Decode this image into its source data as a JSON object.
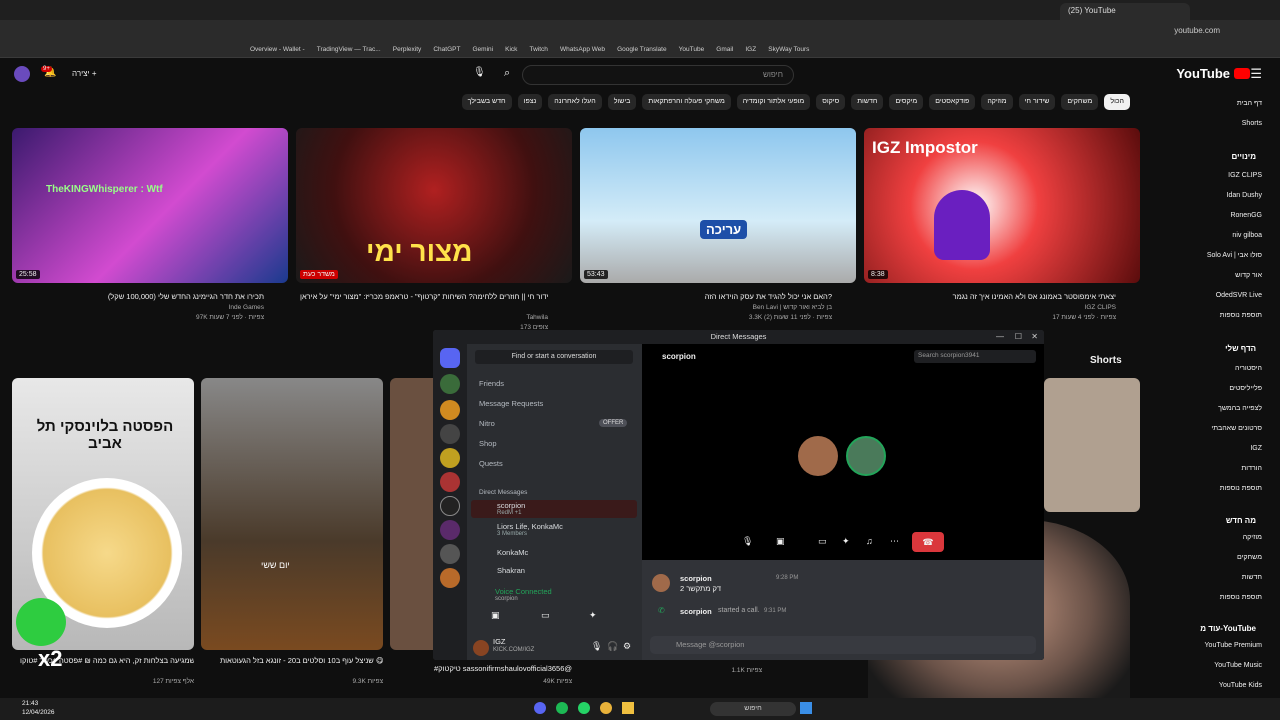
{
  "browser": {
    "tab_title": "(25) YouTube",
    "url": "youtube.com",
    "bookmarks": [
      "Overview - Wallet -",
      "TradingView — Trac...",
      "Perplexity",
      "ChatGPT",
      "Gemini",
      "Kick",
      "Twitch",
      "WhatsApp Web",
      "Google Translate",
      "YouTube",
      "Gmail",
      "IGZ",
      "SkyWay Tours"
    ]
  },
  "yt": {
    "logo": "YouTube",
    "search_placeholder": "חיפוש",
    "create": "יצירה",
    "notif_count": "9+",
    "chips": [
      "הכול",
      "משחקים",
      "שידור חי",
      "מוזיקה",
      "פודקאסטים",
      "מיקסים",
      "חדשות",
      "סיקוס",
      "מופעי אלתור וקומדיה",
      "משחקי פעולה והרפתקאות",
      "בישול",
      "העלו לאחרונה",
      "נצפו",
      "חדש בשבילך"
    ],
    "sidebar": {
      "home": "דף הבית",
      "shorts": "Shorts",
      "subs_head": "מינויים",
      "subs": [
        "IGZ CLIPS",
        "Idan Dushy",
        "RonenGG",
        "niv gilboa",
        "Solo Avi | סולו אבי",
        "אור קדוש",
        "OdedSVR Live",
        "תוספת נוספות"
      ],
      "you_head": "הדף שלי",
      "you": [
        "היסטוריה",
        "פלייליסטים",
        "לצפייה בהמשך",
        "סרטונים שאהבתי",
        "IGZ",
        "הורדות",
        "תוספת נוספות"
      ],
      "explore_head": "מה חדש",
      "explore": [
        "מוזיקה",
        "משחקים",
        "חדשות",
        "תוספת נוספות"
      ],
      "more_head": "עוד מ-YouTube",
      "more": [
        "YouTube Premium",
        "YouTube Music",
        "YouTube Kids"
      ]
    },
    "videos": [
      {
        "title": "תכירו את חדר הגיימינג החדש שלי (100,000 שקל)",
        "channel": "Inde Games",
        "meta": "97K צפיות · לפני 7 שעות",
        "dur": "25:58",
        "overlay": "TheKINGWhisperer : Wtf"
      },
      {
        "title": "שידור חי || חוזרים ללחימה? השיחות \"קרטוף\" - טראמפ מכריז: \"מצור ימי\" על איראן",
        "channel": "Tahwila",
        "meta": "צופים 173",
        "dur": "משדר כעת",
        "overlay": "מצור ימי"
      },
      {
        "title": "האם אני יכול להגיד את עסק הוידאו הזה?",
        "channel": "Ben Lavi | בן לביא ואור קדוש",
        "meta": "3.3K צפיות · לפני 11 שעות (2)",
        "dur": "53:43",
        "overlay": "עריכה"
      },
      {
        "title": "יצאתי אימפוסטר באמונג אס ולא האמינו איך זה נגמר",
        "channel": "IGZ CLIPS",
        "meta": "17 צפיות · לפני 4 שעות",
        "dur": "8:38",
        "overlay": "IGZ Impostor"
      }
    ],
    "shorts_head": "Shorts",
    "shorts": [
      {
        "title": "תכירו את הפסטה הסודית שמגיעה בצלחות זק, היא גם כמה ₪ #פסטה #כשר #טוקו",
        "views": "127 אלף צפיות",
        "overlay": "הפסטה בלוינסקי תל אביב"
      },
      {
        "title": "שניצל עוף ב10 וסלטים ב20 - זונגא בזל הגעוטאות 😋",
        "views": "9.3K צפיות",
        "overlay": "יום ששי"
      },
      {
        "title": "#טיקטוק sassonifirmshaulovofficial3656@",
        "views": "49K צפיות",
        "overlay": ""
      },
      {
        "title": "",
        "views": "1.1K צפיות",
        "overlay": ""
      }
    ]
  },
  "discord": {
    "window_title": "Direct Messages",
    "find": "Find or start a conversation",
    "nav": [
      "Friends",
      "Message Requests",
      "Nitro",
      "Shop",
      "Quests"
    ],
    "nitro_badge": "OFFER",
    "dm_head": "Direct Messages",
    "dms": [
      {
        "name": "scorpion",
        "sub": "RedM +1"
      },
      {
        "name": "Liors Life, KonkaMc",
        "sub": "3 Members"
      },
      {
        "name": "KonkaMc",
        "sub": ""
      },
      {
        "name": "Shakran",
        "sub": ""
      }
    ],
    "voice": "Voice Connected",
    "voice_sub": "scorpion",
    "user": "IGZ",
    "user_sub": "KICK.COM/IGZ",
    "chat_user": "scorpion",
    "chat_search": "Search scorpion3941",
    "msg1_time": "9:28 PM",
    "msg1": "2 דק מתקשר",
    "msg2": "started a call.",
    "msg2_time": "9:31 PM",
    "input_placeholder": "Message @scorpion"
  },
  "taskbar": {
    "time": "21:43",
    "date": "12/04/2026",
    "search": "חיפוש"
  },
  "overlay": {
    "badge": "x2"
  }
}
